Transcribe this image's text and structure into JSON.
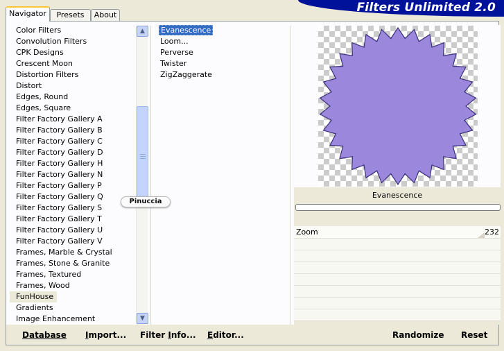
{
  "window": {
    "title": "Filters Unlimited 2.0"
  },
  "tabs": [
    {
      "label": "Navigator",
      "active": true
    },
    {
      "label": "Presets",
      "active": false
    },
    {
      "label": "About",
      "active": false
    }
  ],
  "categories": {
    "items": [
      "Color Filters",
      "Convolution Filters",
      "CPK Designs",
      "Crescent Moon",
      "Distortion Filters",
      "Distort",
      "Edges, Round",
      "Edges, Square",
      "Filter Factory Gallery A",
      "Filter Factory Gallery B",
      "Filter Factory Gallery C",
      "Filter Factory Gallery D",
      "Filter Factory Gallery H",
      "Filter Factory Gallery N",
      "Filter Factory Gallery P",
      "Filter Factory Gallery Q",
      "Filter Factory Gallery S",
      "Filter Factory Gallery T",
      "Filter Factory Gallery U",
      "Filter Factory Gallery V",
      "Frames, Marble & Crystal",
      "Frames, Stone & Granite",
      "Frames, Textured",
      "Frames, Wood",
      "FunHouse",
      "Gradients",
      "Image Enhancement"
    ],
    "selected": "FunHouse",
    "scroll_up_icon": "chevron-up-icon",
    "scroll_down_icon": "chevron-down-icon"
  },
  "filters": {
    "items": [
      "Evanescence",
      "Loom...",
      "Perverse",
      "Twister",
      "ZigZaggerate"
    ],
    "selected": "Evanescence"
  },
  "preview": {
    "filter_name": "Evanescence",
    "seal_color": "#9b87dc",
    "seal_edge_color": "#3a2f7a",
    "progress": 0
  },
  "params": {
    "zoom_label": "Zoom",
    "zoom_value": "232"
  },
  "buttons": {
    "database": {
      "label": "Database",
      "underline": "D",
      "rest": "atabase"
    },
    "import": {
      "label": "Import...",
      "underline": "I",
      "rest": "mport..."
    },
    "filter_info_pre": "Filter ",
    "filter_info_u": "I",
    "filter_info_rest": "nfo...",
    "editor_u": "E",
    "editor_rest": "ditor...",
    "randomize": "Randomize",
    "reset": "Reset"
  },
  "watermark": "Pinuccia"
}
